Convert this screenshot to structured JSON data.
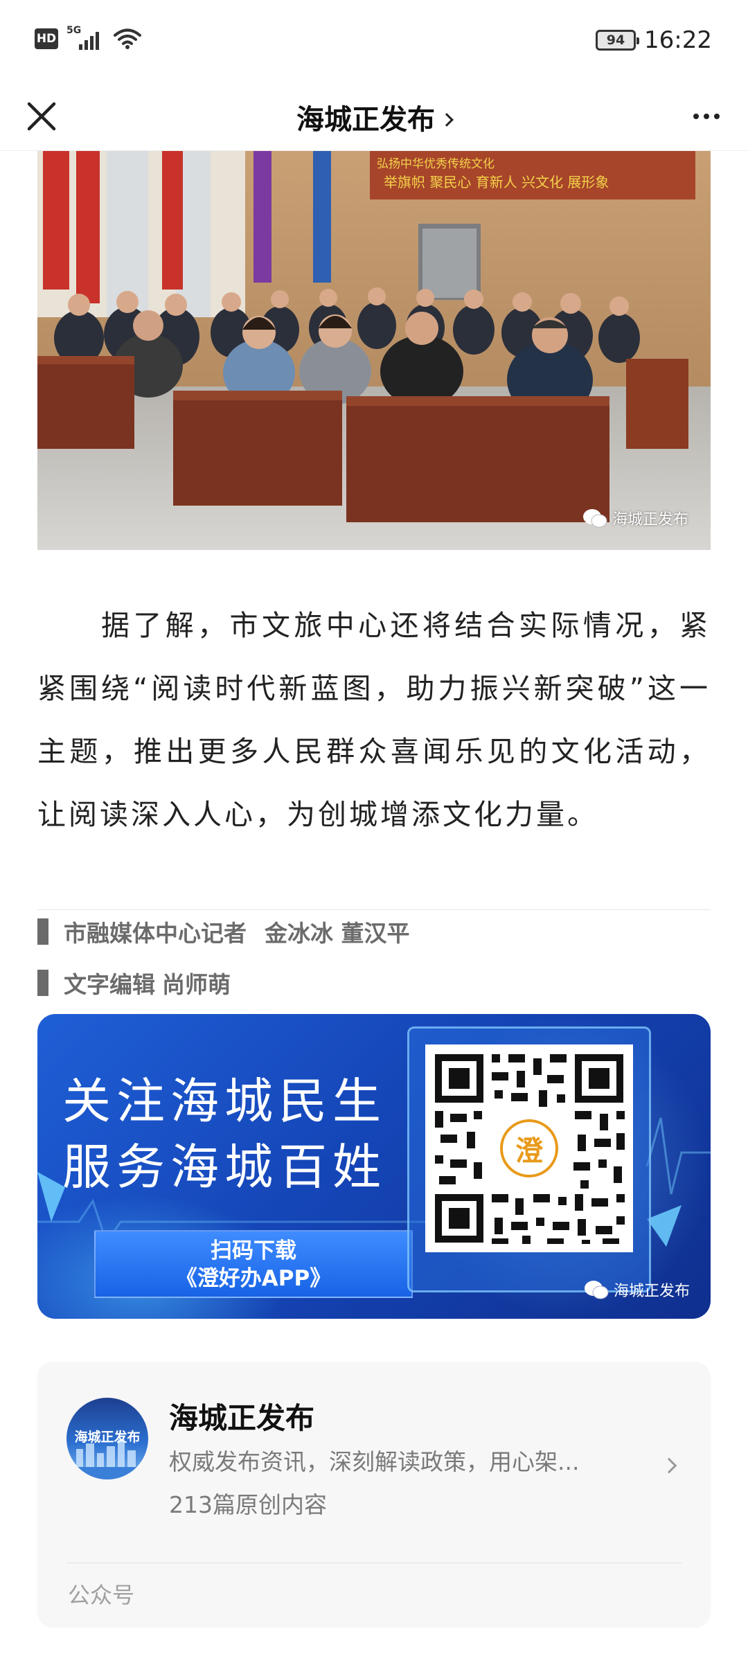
{
  "status_bar": {
    "hd_label": "HD",
    "network": "5G",
    "battery": "94",
    "time": "16:22"
  },
  "header": {
    "title": "海城正发布"
  },
  "photo": {
    "banner_line1": "弘扬中华优秀传统文化",
    "banner_line2": "举旗帜 聚民心 育新人 兴文化 展形象",
    "watermark": "海城正发布"
  },
  "article": {
    "paragraph": "据了解，市文旅中心还将结合实际情况，紧紧围绕“阅读时代新蓝图，助力振兴新突破”这一主题，推出更多人民群众喜闻乐见的文化活动，让阅读深入人心，为创城增添文化力量。"
  },
  "credits": {
    "reporter_label": "市融媒体中心记者",
    "reporters": "金冰冰 董汉平",
    "editor_label": "文字编辑",
    "editor": "尚师萌"
  },
  "banner": {
    "line1": "关注海城民生",
    "line2": "服务海城百姓",
    "button_line1": "扫码下载",
    "button_line2": "《澄好办APP》",
    "qr_logo": "澄",
    "watermark": "海城正发布"
  },
  "account_card": {
    "avatar_text": "海城正发布",
    "name": "海城正发布",
    "description": "权威发布资讯，深刻解读政策，用心架...",
    "original_count": "213篇原创内容",
    "type": "公众号"
  },
  "colors": {
    "banner_blue": "#1546b8",
    "qr_logo_orange": "#e89a1a",
    "credit_gray": "#6b6b6b"
  }
}
